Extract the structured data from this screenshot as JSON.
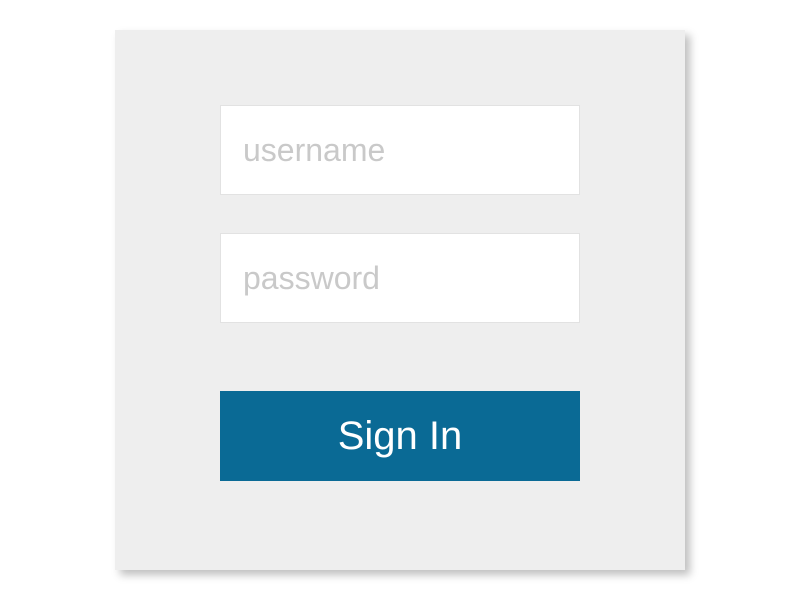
{
  "login": {
    "username_placeholder": "username",
    "password_placeholder": "password",
    "signin_label": "Sign In"
  },
  "colors": {
    "card_bg": "#eeeeee",
    "button_bg": "#0a6a95",
    "placeholder": "#c9c9c9"
  }
}
